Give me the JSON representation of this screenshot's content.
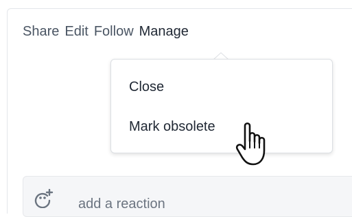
{
  "toolbar": {
    "items": [
      {
        "label": "Share"
      },
      {
        "label": "Edit"
      },
      {
        "label": "Follow"
      },
      {
        "label": "Manage",
        "active": true
      }
    ]
  },
  "manage_menu": {
    "items": [
      {
        "label": "Close"
      },
      {
        "label": "Mark obsolete"
      }
    ]
  },
  "reaction": {
    "label": "add a reaction",
    "icon": "add-reaction-icon"
  },
  "cursor": {
    "icon": "hand-pointer-icon"
  },
  "colors": {
    "text_muted": "#4a5563",
    "text_dark": "#1f2733",
    "border": "#dcdfe3",
    "reaction_bg": "#f5f6f8"
  }
}
